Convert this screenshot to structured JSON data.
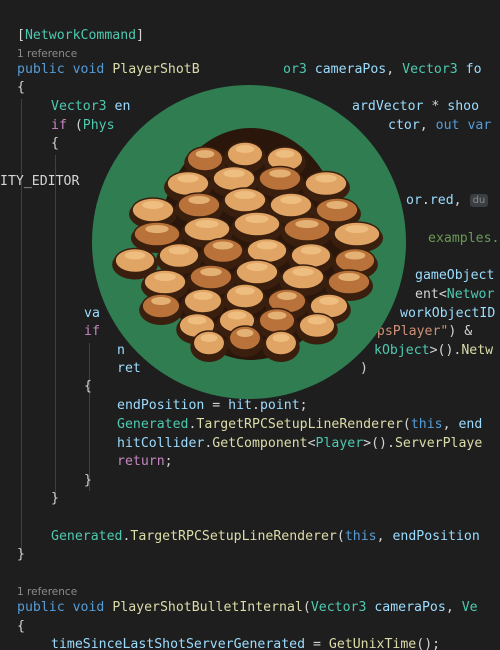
{
  "colors": {
    "background": "#1e1e1e",
    "keyword": "#569cd6",
    "type": "#4ec9b0",
    "method": "#dcdcaa",
    "variable": "#9cdcfe",
    "control": "#c586c0",
    "string": "#ce9178",
    "comment": "#6a9955",
    "logo_circle": "#2f7d51",
    "logo_scale_light": "#e0a464",
    "logo_scale_dark": "#3a1f0e"
  },
  "icons": {
    "logo": "pinecone-logo"
  },
  "code": {
    "l1": {
      "a": "[",
      "b": "NetworkCommand",
      "c": "]"
    },
    "ref1": "1 reference",
    "l2": {
      "a": "public",
      "b": " ",
      "c": "void",
      "d": " ",
      "e": "PlayerShotB",
      "f": "",
      "g": "or3 ",
      "h": "cameraPos",
      "i": ", ",
      "j": "Vector3",
      "k": " ",
      "l": "fo"
    },
    "l3": {
      "a": "{"
    },
    "l4": {
      "a": "Vector3",
      "b": " ",
      "c": "en",
      "d": "ardVector",
      "e": " * ",
      "f": "shoo"
    },
    "l5": {
      "a": "if",
      "b": " (",
      "c": "Phys",
      "d": "ctor",
      "e": ", ",
      "f": "out",
      "g": " ",
      "h": "var"
    },
    "l6": {
      "a": "{"
    },
    "l7": {
      "a": "ITY_EDITOR"
    },
    "l8": {
      "a": "or",
      "b": ".",
      "c": "red",
      "d": ", ",
      "e": "du"
    },
    "l9": {
      "a": "examples."
    },
    "l10": {
      "a": "gameObject"
    },
    "l11": {
      "a": "ent<",
      "b": "Networ"
    },
    "l12": {
      "a": "va",
      "b": "workObjectID"
    },
    "l13": {
      "a": "if",
      "b": "\"FpsPlayer\"",
      "c": ") &"
    },
    "l14": {
      "a": "n",
      "b": "kObject",
      "c": ">().",
      "d": "Netw"
    },
    "l15": {
      "a": "ret",
      "b": ")"
    },
    "l16": {
      "a": "{"
    },
    "l17": {
      "a": "endPosition",
      "b": " = ",
      "c": "hit",
      "d": ".",
      "e": "point",
      "f": ";"
    },
    "l18": {
      "a": "Generated",
      "b": ".",
      "c": "TargetRPCSetupLineRenderer",
      "d": "(",
      "e": "this",
      "f": ", ",
      "g": "end"
    },
    "l19": {
      "a": "hitCollider",
      "b": ".",
      "c": "GetComponent",
      "d": "<",
      "e": "Player",
      "f": ">().",
      "g": "ServerPlaye"
    },
    "l20": {
      "a": "return",
      "b": ";"
    },
    "l21": {
      "a": "}"
    },
    "l22": {
      "a": "}"
    },
    "l23": {
      "a": "Generated",
      "b": ".",
      "c": "TargetRPCSetupLineRenderer",
      "d": "(",
      "e": "this",
      "f": ", ",
      "g": "endPosition"
    },
    "l24": {
      "a": "}"
    },
    "ref2": "1 reference",
    "l25": {
      "a": "public",
      "b": " ",
      "c": "void",
      "d": " ",
      "e": "PlayerShotBulletInternal",
      "f": "(",
      "g": "Vector3",
      "h": " ",
      "i": "cameraPos",
      "j": ", ",
      "k": "Ve"
    },
    "l26": {
      "a": "{"
    },
    "l27": {
      "a": "timeSinceLastShotServerGenerated",
      "b": " = ",
      "c": "GetUnixTime",
      "d": "();"
    }
  }
}
